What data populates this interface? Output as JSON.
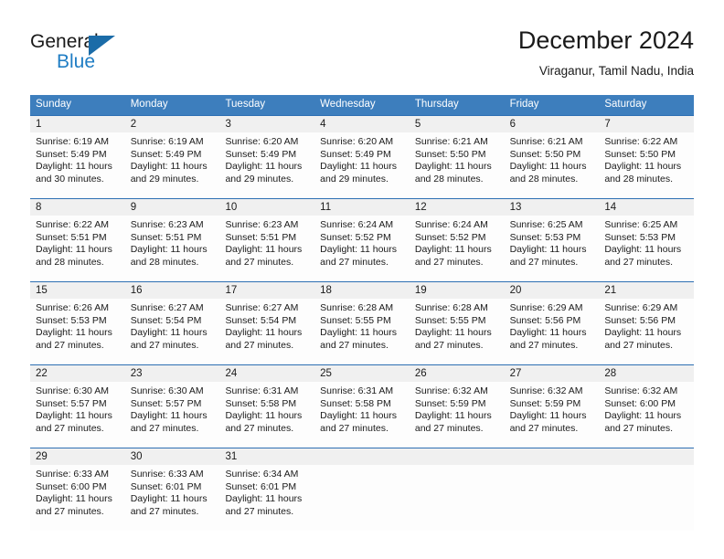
{
  "brand": {
    "name_part1": "General",
    "name_part2": "Blue",
    "logo_icon": "triangle-icon",
    "accent_color": "#1b6ca8",
    "blue_text_color": "#1f7dc4"
  },
  "header": {
    "month_title": "December 2024",
    "location": "Viraganur, Tamil Nadu, India"
  },
  "calendar": {
    "header_bg": "#3d7ebd",
    "daynum_bg": "#f0f0f0",
    "separator_color": "#2d6fb3",
    "weekdays": [
      "Sunday",
      "Monday",
      "Tuesday",
      "Wednesday",
      "Thursday",
      "Friday",
      "Saturday"
    ],
    "weeks": [
      [
        {
          "day": "1",
          "sunrise": "Sunrise: 6:19 AM",
          "sunset": "Sunset: 5:49 PM",
          "daylight_1": "Daylight: 11 hours",
          "daylight_2": "and 30 minutes."
        },
        {
          "day": "2",
          "sunrise": "Sunrise: 6:19 AM",
          "sunset": "Sunset: 5:49 PM",
          "daylight_1": "Daylight: 11 hours",
          "daylight_2": "and 29 minutes."
        },
        {
          "day": "3",
          "sunrise": "Sunrise: 6:20 AM",
          "sunset": "Sunset: 5:49 PM",
          "daylight_1": "Daylight: 11 hours",
          "daylight_2": "and 29 minutes."
        },
        {
          "day": "4",
          "sunrise": "Sunrise: 6:20 AM",
          "sunset": "Sunset: 5:49 PM",
          "daylight_1": "Daylight: 11 hours",
          "daylight_2": "and 29 minutes."
        },
        {
          "day": "5",
          "sunrise": "Sunrise: 6:21 AM",
          "sunset": "Sunset: 5:50 PM",
          "daylight_1": "Daylight: 11 hours",
          "daylight_2": "and 28 minutes."
        },
        {
          "day": "6",
          "sunrise": "Sunrise: 6:21 AM",
          "sunset": "Sunset: 5:50 PM",
          "daylight_1": "Daylight: 11 hours",
          "daylight_2": "and 28 minutes."
        },
        {
          "day": "7",
          "sunrise": "Sunrise: 6:22 AM",
          "sunset": "Sunset: 5:50 PM",
          "daylight_1": "Daylight: 11 hours",
          "daylight_2": "and 28 minutes."
        }
      ],
      [
        {
          "day": "8",
          "sunrise": "Sunrise: 6:22 AM",
          "sunset": "Sunset: 5:51 PM",
          "daylight_1": "Daylight: 11 hours",
          "daylight_2": "and 28 minutes."
        },
        {
          "day": "9",
          "sunrise": "Sunrise: 6:23 AM",
          "sunset": "Sunset: 5:51 PM",
          "daylight_1": "Daylight: 11 hours",
          "daylight_2": "and 28 minutes."
        },
        {
          "day": "10",
          "sunrise": "Sunrise: 6:23 AM",
          "sunset": "Sunset: 5:51 PM",
          "daylight_1": "Daylight: 11 hours",
          "daylight_2": "and 27 minutes."
        },
        {
          "day": "11",
          "sunrise": "Sunrise: 6:24 AM",
          "sunset": "Sunset: 5:52 PM",
          "daylight_1": "Daylight: 11 hours",
          "daylight_2": "and 27 minutes."
        },
        {
          "day": "12",
          "sunrise": "Sunrise: 6:24 AM",
          "sunset": "Sunset: 5:52 PM",
          "daylight_1": "Daylight: 11 hours",
          "daylight_2": "and 27 minutes."
        },
        {
          "day": "13",
          "sunrise": "Sunrise: 6:25 AM",
          "sunset": "Sunset: 5:53 PM",
          "daylight_1": "Daylight: 11 hours",
          "daylight_2": "and 27 minutes."
        },
        {
          "day": "14",
          "sunrise": "Sunrise: 6:25 AM",
          "sunset": "Sunset: 5:53 PM",
          "daylight_1": "Daylight: 11 hours",
          "daylight_2": "and 27 minutes."
        }
      ],
      [
        {
          "day": "15",
          "sunrise": "Sunrise: 6:26 AM",
          "sunset": "Sunset: 5:53 PM",
          "daylight_1": "Daylight: 11 hours",
          "daylight_2": "and 27 minutes."
        },
        {
          "day": "16",
          "sunrise": "Sunrise: 6:27 AM",
          "sunset": "Sunset: 5:54 PM",
          "daylight_1": "Daylight: 11 hours",
          "daylight_2": "and 27 minutes."
        },
        {
          "day": "17",
          "sunrise": "Sunrise: 6:27 AM",
          "sunset": "Sunset: 5:54 PM",
          "daylight_1": "Daylight: 11 hours",
          "daylight_2": "and 27 minutes."
        },
        {
          "day": "18",
          "sunrise": "Sunrise: 6:28 AM",
          "sunset": "Sunset: 5:55 PM",
          "daylight_1": "Daylight: 11 hours",
          "daylight_2": "and 27 minutes."
        },
        {
          "day": "19",
          "sunrise": "Sunrise: 6:28 AM",
          "sunset": "Sunset: 5:55 PM",
          "daylight_1": "Daylight: 11 hours",
          "daylight_2": "and 27 minutes."
        },
        {
          "day": "20",
          "sunrise": "Sunrise: 6:29 AM",
          "sunset": "Sunset: 5:56 PM",
          "daylight_1": "Daylight: 11 hours",
          "daylight_2": "and 27 minutes."
        },
        {
          "day": "21",
          "sunrise": "Sunrise: 6:29 AM",
          "sunset": "Sunset: 5:56 PM",
          "daylight_1": "Daylight: 11 hours",
          "daylight_2": "and 27 minutes."
        }
      ],
      [
        {
          "day": "22",
          "sunrise": "Sunrise: 6:30 AM",
          "sunset": "Sunset: 5:57 PM",
          "daylight_1": "Daylight: 11 hours",
          "daylight_2": "and 27 minutes."
        },
        {
          "day": "23",
          "sunrise": "Sunrise: 6:30 AM",
          "sunset": "Sunset: 5:57 PM",
          "daylight_1": "Daylight: 11 hours",
          "daylight_2": "and 27 minutes."
        },
        {
          "day": "24",
          "sunrise": "Sunrise: 6:31 AM",
          "sunset": "Sunset: 5:58 PM",
          "daylight_1": "Daylight: 11 hours",
          "daylight_2": "and 27 minutes."
        },
        {
          "day": "25",
          "sunrise": "Sunrise: 6:31 AM",
          "sunset": "Sunset: 5:58 PM",
          "daylight_1": "Daylight: 11 hours",
          "daylight_2": "and 27 minutes."
        },
        {
          "day": "26",
          "sunrise": "Sunrise: 6:32 AM",
          "sunset": "Sunset: 5:59 PM",
          "daylight_1": "Daylight: 11 hours",
          "daylight_2": "and 27 minutes."
        },
        {
          "day": "27",
          "sunrise": "Sunrise: 6:32 AM",
          "sunset": "Sunset: 5:59 PM",
          "daylight_1": "Daylight: 11 hours",
          "daylight_2": "and 27 minutes."
        },
        {
          "day": "28",
          "sunrise": "Sunrise: 6:32 AM",
          "sunset": "Sunset: 6:00 PM",
          "daylight_1": "Daylight: 11 hours",
          "daylight_2": "and 27 minutes."
        }
      ],
      [
        {
          "day": "29",
          "sunrise": "Sunrise: 6:33 AM",
          "sunset": "Sunset: 6:00 PM",
          "daylight_1": "Daylight: 11 hours",
          "daylight_2": "and 27 minutes."
        },
        {
          "day": "30",
          "sunrise": "Sunrise: 6:33 AM",
          "sunset": "Sunset: 6:01 PM",
          "daylight_1": "Daylight: 11 hours",
          "daylight_2": "and 27 minutes."
        },
        {
          "day": "31",
          "sunrise": "Sunrise: 6:34 AM",
          "sunset": "Sunset: 6:01 PM",
          "daylight_1": "Daylight: 11 hours",
          "daylight_2": "and 27 minutes."
        },
        {
          "day": "",
          "sunrise": "",
          "sunset": "",
          "daylight_1": "",
          "daylight_2": ""
        },
        {
          "day": "",
          "sunrise": "",
          "sunset": "",
          "daylight_1": "",
          "daylight_2": ""
        },
        {
          "day": "",
          "sunrise": "",
          "sunset": "",
          "daylight_1": "",
          "daylight_2": ""
        },
        {
          "day": "",
          "sunrise": "",
          "sunset": "",
          "daylight_1": "",
          "daylight_2": ""
        }
      ]
    ]
  }
}
